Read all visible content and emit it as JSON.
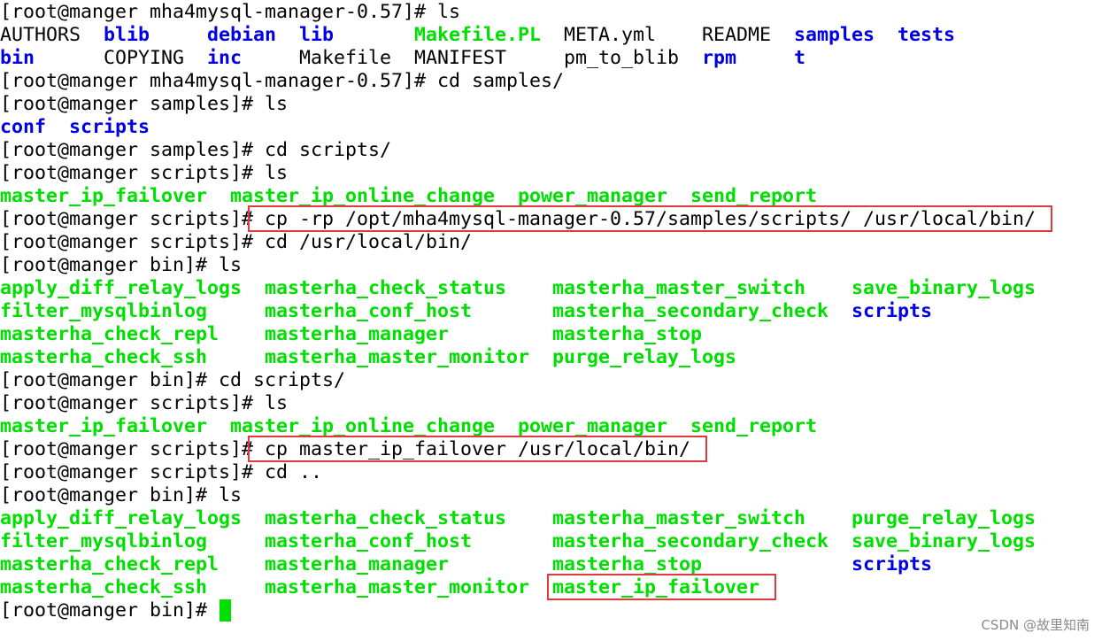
{
  "terminal": {
    "lines": [
      {
        "tokens": [
          {
            "col": 0,
            "text": "[root@manger mha4mysql-manager-0.57]# ls",
            "color": "normal"
          }
        ]
      },
      {
        "tokens": [
          {
            "col": 0,
            "text": "AUTHORS",
            "color": "normal"
          },
          {
            "col": 9,
            "text": "blib",
            "color": "dir"
          },
          {
            "col": 18,
            "text": "debian",
            "color": "dir"
          },
          {
            "col": 26,
            "text": "lib",
            "color": "dir"
          },
          {
            "col": 36,
            "text": "Makefile.PL",
            "color": "exec"
          },
          {
            "col": 49,
            "text": "META.yml",
            "color": "normal"
          },
          {
            "col": 61,
            "text": "README",
            "color": "normal"
          },
          {
            "col": 69,
            "text": "samples",
            "color": "dir"
          },
          {
            "col": 78,
            "text": "tests",
            "color": "dir"
          }
        ]
      },
      {
        "tokens": [
          {
            "col": 0,
            "text": "bin",
            "color": "dir"
          },
          {
            "col": 9,
            "text": "COPYING",
            "color": "normal"
          },
          {
            "col": 18,
            "text": "inc",
            "color": "dir"
          },
          {
            "col": 26,
            "text": "Makefile",
            "color": "normal"
          },
          {
            "col": 36,
            "text": "MANIFEST",
            "color": "normal"
          },
          {
            "col": 49,
            "text": "pm_to_blib",
            "color": "normal"
          },
          {
            "col": 61,
            "text": "rpm",
            "color": "dir"
          },
          {
            "col": 69,
            "text": "t",
            "color": "dir"
          }
        ]
      },
      {
        "tokens": [
          {
            "col": 0,
            "text": "[root@manger mha4mysql-manager-0.57]# cd samples/",
            "color": "normal"
          }
        ]
      },
      {
        "tokens": [
          {
            "col": 0,
            "text": "[root@manger samples]# ls",
            "color": "normal"
          }
        ]
      },
      {
        "tokens": [
          {
            "col": 0,
            "text": "conf",
            "color": "dir"
          },
          {
            "col": 6,
            "text": "scripts",
            "color": "dir"
          }
        ]
      },
      {
        "tokens": [
          {
            "col": 0,
            "text": "[root@manger samples]# cd scripts/",
            "color": "normal"
          }
        ]
      },
      {
        "tokens": [
          {
            "col": 0,
            "text": "[root@manger scripts]# ls",
            "color": "normal"
          }
        ]
      },
      {
        "tokens": [
          {
            "col": 0,
            "text": "master_ip_failover",
            "color": "exec"
          },
          {
            "col": 20,
            "text": "master_ip_online_change",
            "color": "exec"
          },
          {
            "col": 45,
            "text": "power_manager",
            "color": "exec"
          },
          {
            "col": 60,
            "text": "send_report",
            "color": "exec"
          }
        ]
      },
      {
        "tokens": [
          {
            "col": 0,
            "text": "[root@manger scripts]# cp -rp /opt/mha4mysql-manager-0.57/samples/scripts/ /usr/local/bin/",
            "color": "normal"
          }
        ]
      },
      {
        "tokens": [
          {
            "col": 0,
            "text": "[root@manger scripts]# cd /usr/local/bin/",
            "color": "normal"
          }
        ]
      },
      {
        "tokens": [
          {
            "col": 0,
            "text": "[root@manger bin]# ls",
            "color": "normal"
          }
        ]
      },
      {
        "tokens": [
          {
            "col": 0,
            "text": "apply_diff_relay_logs",
            "color": "exec"
          },
          {
            "col": 23,
            "text": "masterha_check_status",
            "color": "exec"
          },
          {
            "col": 48,
            "text": "masterha_master_switch",
            "color": "exec"
          },
          {
            "col": 74,
            "text": "save_binary_logs",
            "color": "exec"
          }
        ]
      },
      {
        "tokens": [
          {
            "col": 0,
            "text": "filter_mysqlbinlog",
            "color": "exec"
          },
          {
            "col": 23,
            "text": "masterha_conf_host",
            "color": "exec"
          },
          {
            "col": 48,
            "text": "masterha_secondary_check",
            "color": "exec"
          },
          {
            "col": 74,
            "text": "scripts",
            "color": "dir"
          }
        ]
      },
      {
        "tokens": [
          {
            "col": 0,
            "text": "masterha_check_repl",
            "color": "exec"
          },
          {
            "col": 23,
            "text": "masterha_manager",
            "color": "exec"
          },
          {
            "col": 48,
            "text": "masterha_stop",
            "color": "exec"
          }
        ]
      },
      {
        "tokens": [
          {
            "col": 0,
            "text": "masterha_check_ssh",
            "color": "exec"
          },
          {
            "col": 23,
            "text": "masterha_master_monitor",
            "color": "exec"
          },
          {
            "col": 48,
            "text": "purge_relay_logs",
            "color": "exec"
          }
        ]
      },
      {
        "tokens": [
          {
            "col": 0,
            "text": "[root@manger bin]# cd scripts/",
            "color": "normal"
          }
        ]
      },
      {
        "tokens": [
          {
            "col": 0,
            "text": "[root@manger scripts]# ls",
            "color": "normal"
          }
        ]
      },
      {
        "tokens": [
          {
            "col": 0,
            "text": "master_ip_failover",
            "color": "exec"
          },
          {
            "col": 20,
            "text": "master_ip_online_change",
            "color": "exec"
          },
          {
            "col": 45,
            "text": "power_manager",
            "color": "exec"
          },
          {
            "col": 60,
            "text": "send_report",
            "color": "exec"
          }
        ]
      },
      {
        "tokens": [
          {
            "col": 0,
            "text": "[root@manger scripts]# cp master_ip_failover /usr/local/bin/",
            "color": "normal"
          }
        ]
      },
      {
        "tokens": [
          {
            "col": 0,
            "text": "[root@manger scripts]# cd ..",
            "color": "normal"
          }
        ]
      },
      {
        "tokens": [
          {
            "col": 0,
            "text": "[root@manger bin]# ls",
            "color": "normal"
          }
        ]
      },
      {
        "tokens": [
          {
            "col": 0,
            "text": "apply_diff_relay_logs",
            "color": "exec"
          },
          {
            "col": 23,
            "text": "masterha_check_status",
            "color": "exec"
          },
          {
            "col": 48,
            "text": "masterha_master_switch",
            "color": "exec"
          },
          {
            "col": 74,
            "text": "purge_relay_logs",
            "color": "exec"
          }
        ]
      },
      {
        "tokens": [
          {
            "col": 0,
            "text": "filter_mysqlbinlog",
            "color": "exec"
          },
          {
            "col": 23,
            "text": "masterha_conf_host",
            "color": "exec"
          },
          {
            "col": 48,
            "text": "masterha_secondary_check",
            "color": "exec"
          },
          {
            "col": 74,
            "text": "save_binary_logs",
            "color": "exec"
          }
        ]
      },
      {
        "tokens": [
          {
            "col": 0,
            "text": "masterha_check_repl",
            "color": "exec"
          },
          {
            "col": 23,
            "text": "masterha_manager",
            "color": "exec"
          },
          {
            "col": 48,
            "text": "masterha_stop",
            "color": "exec"
          },
          {
            "col": 74,
            "text": "scripts",
            "color": "dir"
          }
        ]
      },
      {
        "tokens": [
          {
            "col": 0,
            "text": "masterha_check_ssh",
            "color": "exec"
          },
          {
            "col": 23,
            "text": "masterha_master_monitor",
            "color": "exec"
          },
          {
            "col": 48,
            "text": "master_ip_failover",
            "color": "exec"
          }
        ]
      },
      {
        "tokens": [
          {
            "col": 0,
            "text": "[root@manger bin]# ",
            "color": "normal"
          }
        ]
      }
    ],
    "highlights": [
      {
        "line": 9,
        "col": 22,
        "length": 69
      },
      {
        "line": 19,
        "col": 22,
        "length": 39
      },
      {
        "line": 25,
        "col": 48,
        "length": 19
      }
    ],
    "cursor": {
      "line": 26,
      "col": 19
    }
  },
  "colors": {
    "background": "#ffffff",
    "normal": "#000000",
    "exec": "#00e000",
    "dir": "#0000e6",
    "highlight": "#e0393e"
  },
  "watermark": "CSDN @故里知南"
}
